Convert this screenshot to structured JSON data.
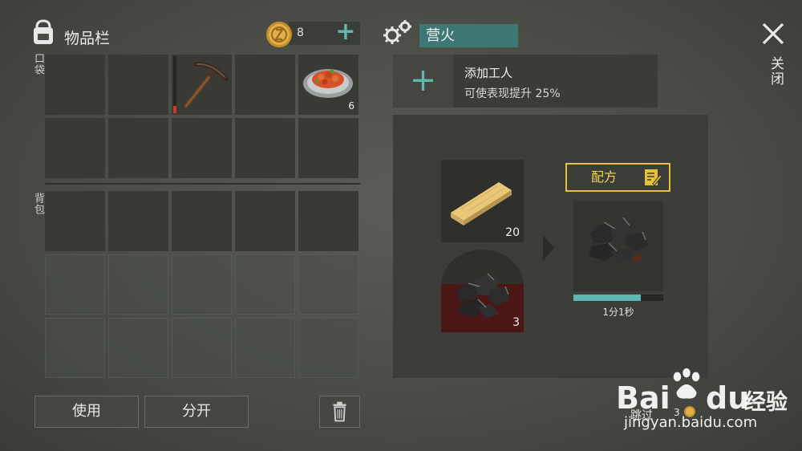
{
  "inventory": {
    "title": "物品栏",
    "coins": "8",
    "pocket_label": "口袋",
    "backpack_label": "背包",
    "pocket_slots": [
      {
        "item": "",
        "qty": ""
      },
      {
        "item": "",
        "qty": ""
      },
      {
        "item": "pickaxe",
        "qty": "",
        "durability": 0.12
      },
      {
        "item": "",
        "qty": ""
      },
      {
        "item": "cooked-food",
        "qty": "6"
      }
    ],
    "actions": {
      "use_label": "使用",
      "split_label": "分开"
    }
  },
  "station": {
    "title": "营火",
    "add_worker": {
      "title": "添加工人",
      "description": "可使表现提升 25%"
    },
    "inputs": [
      {
        "item": "wood-plank",
        "qty": "20"
      },
      {
        "item": "coal",
        "qty": "3"
      }
    ],
    "recipe_label": "配方",
    "output": {
      "item": "coal",
      "progress": 0.75,
      "time": "1分1秒"
    },
    "skip": {
      "label": "跳过",
      "cost": "3"
    }
  },
  "close_label": "关闭",
  "watermark": {
    "brand": "Bai",
    "brand2": "du",
    "product": "经验",
    "url": "jingyan.baidu.com"
  },
  "colors": {
    "accent": "#5fb8b0",
    "recipe": "#e3c13a",
    "station_title_bg": "#3f7774"
  }
}
